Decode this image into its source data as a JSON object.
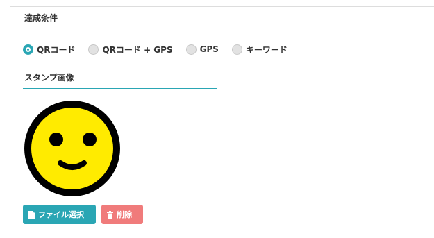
{
  "achievement": {
    "title": "達成条件",
    "options": [
      {
        "label": "QRコード",
        "checked": true
      },
      {
        "label": "QRコード + GPS",
        "checked": false
      },
      {
        "label": "GPS",
        "checked": false
      },
      {
        "label": "キーワード",
        "checked": false
      }
    ]
  },
  "stamp": {
    "title": "スタンプ画像",
    "image_icon": "smiley-face-icon",
    "colors": {
      "face": "#ffeb00",
      "outline": "#000000"
    }
  },
  "buttons": {
    "file_select": {
      "label": "ファイル選択",
      "icon": "file-icon"
    },
    "delete": {
      "label": "削除",
      "icon": "trash-icon"
    }
  },
  "colors": {
    "accent": "#2aa6b4",
    "danger": "#f07b7b"
  }
}
